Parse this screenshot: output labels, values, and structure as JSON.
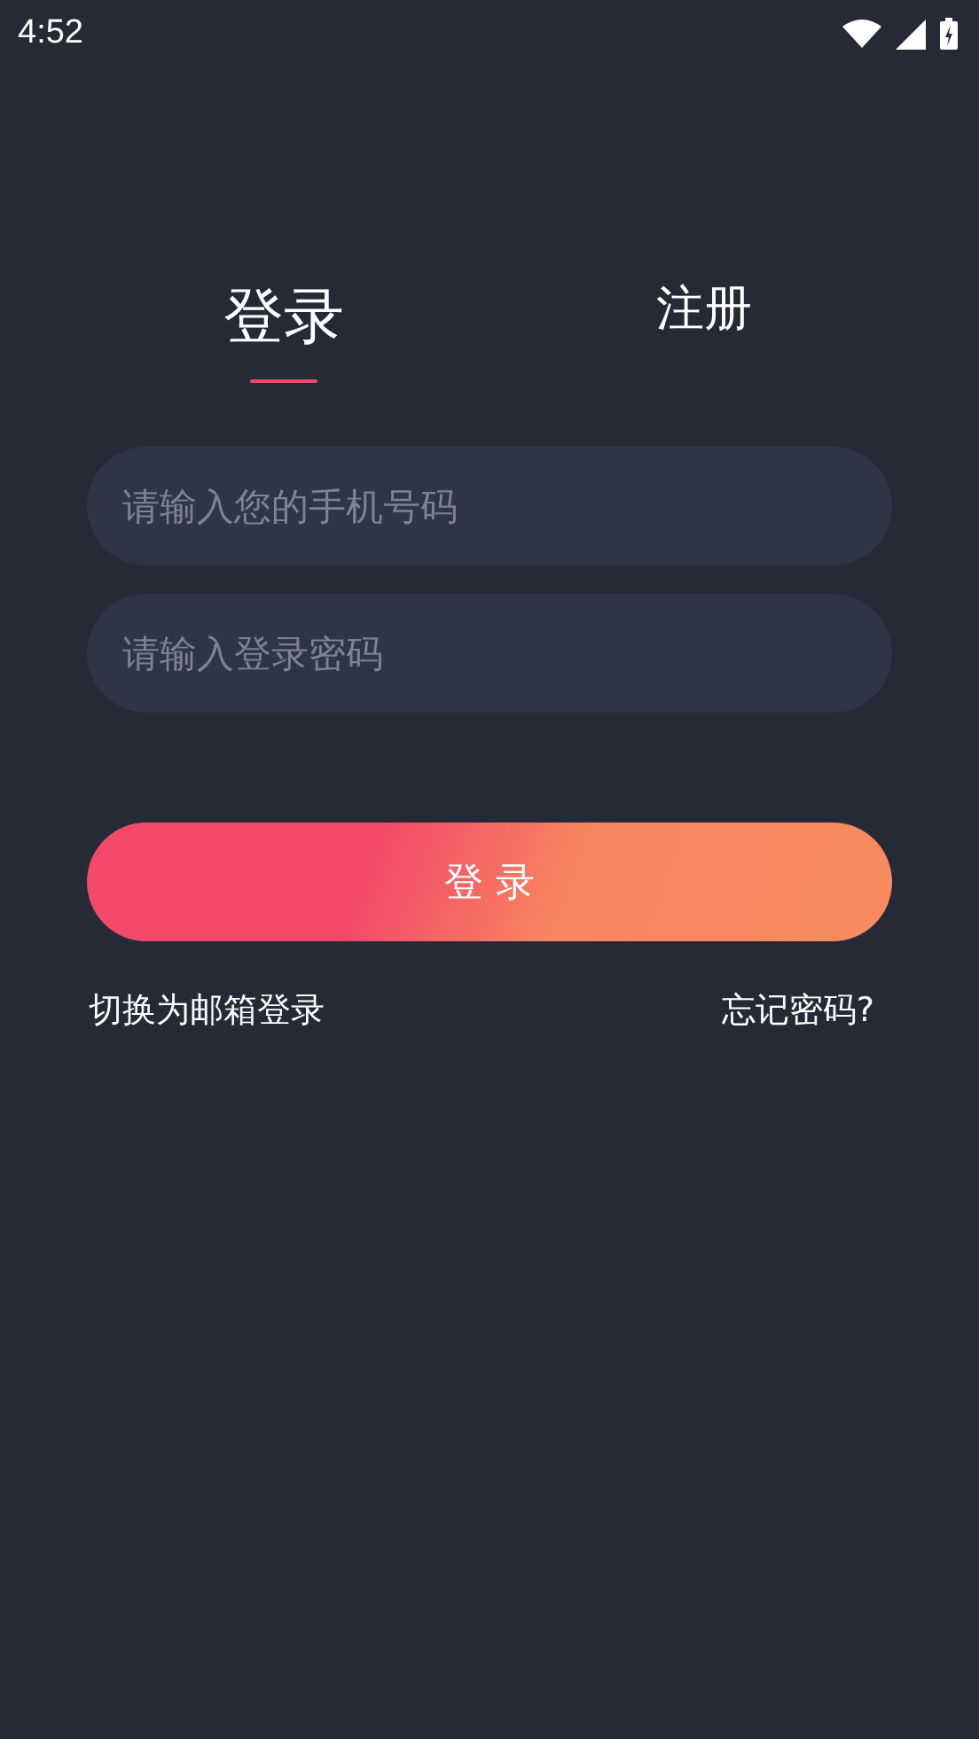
{
  "status_bar": {
    "time": "4:52"
  },
  "tabs": [
    {
      "label": "登录",
      "selected": true
    },
    {
      "label": "注册",
      "selected": false
    }
  ],
  "fields": [
    {
      "placeholder": "请输入您的手机号码"
    },
    {
      "placeholder": "请输入登录密码"
    }
  ],
  "login_button": "登 录",
  "links": {
    "switch": "切换为邮箱登录",
    "forgot": "忘记密码?"
  }
}
